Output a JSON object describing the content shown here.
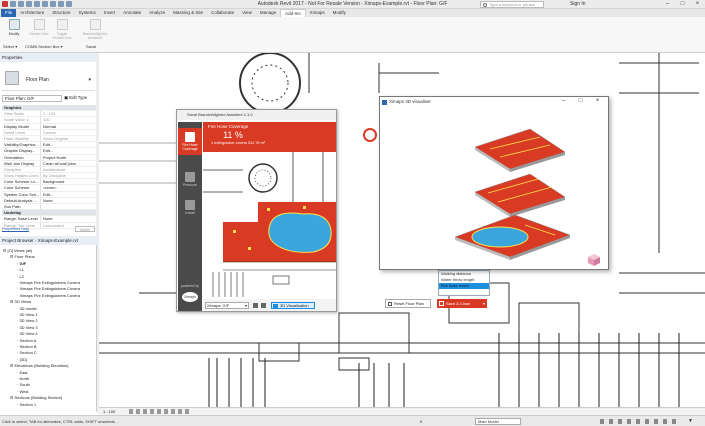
{
  "app_title": "Autodesk Revit 2017 - Not For Resale Version - Ximaps-Example.rvt - Floor Plan: G/F",
  "search_placeholder": "Type a keyword or phrase",
  "sign_in": "Sign In",
  "tabs": [
    "File",
    "Architecture",
    "Structure",
    "Systems",
    "Insert",
    "Annotate",
    "Analyze",
    "Massing & Site",
    "Collaborate",
    "View",
    "Manage",
    "Add-Ins",
    "Ximaps",
    "Modify"
  ],
  "active_tab": "Add-Ins",
  "ribbon": {
    "modify": "Modify",
    "buttons": [
      "Section Box",
      "Toggle Section Box",
      "Section Box",
      "Brandveiligheid Assistent"
    ],
    "panels": [
      "Select ▾",
      "COMB Section Box ▾",
      "Saval"
    ]
  },
  "properties": {
    "header": "Properties",
    "type_name": "Floor Plan",
    "selector": "Floor Plan: G/F",
    "edit_type": "Edit Type",
    "rows": [
      {
        "k": "Graphics",
        "v": "",
        "hdr": true
      },
      {
        "k": "View Scale",
        "v": "1 : 100",
        "grey": true
      },
      {
        "k": "Scale Value 1:",
        "v": "100",
        "grey": true
      },
      {
        "k": "Display Model",
        "v": "Normal"
      },
      {
        "k": "Detail Level",
        "v": "Coarse",
        "grey": true
      },
      {
        "k": "Parts Visibility",
        "v": "Show Original",
        "grey": true
      },
      {
        "k": "Visibility/Graphics...",
        "v": "Edit..."
      },
      {
        "k": "Graphic Display...",
        "v": "Edit..."
      },
      {
        "k": "Orientation",
        "v": "Project North"
      },
      {
        "k": "Wall Join Display",
        "v": "Clean all wall joins"
      },
      {
        "k": "Discipline",
        "v": "Architectural",
        "grey": true
      },
      {
        "k": "Show Hidden Lines",
        "v": "By Discipline",
        "grey": true
      },
      {
        "k": "Color Scheme Lo...",
        "v": "Background"
      },
      {
        "k": "Color Scheme",
        "v": "<none>"
      },
      {
        "k": "System Color Sch...",
        "v": "Edit..."
      },
      {
        "k": "Default Analysis ...",
        "v": "None"
      },
      {
        "k": "Sun Path",
        "v": ""
      },
      {
        "k": "Underlay",
        "v": "",
        "hdr": true
      },
      {
        "k": "Range: Base Level",
        "v": "None"
      },
      {
        "k": "Range: Top Level",
        "v": "Unbounded",
        "grey": true
      }
    ],
    "help_link": "Properties help",
    "apply": "Apply"
  },
  "browser": {
    "header": "Project Browser - Ximaps-Example.rvt",
    "items": [
      {
        "t": "[O] Views (all)",
        "d": 0
      },
      {
        "t": "Floor Plans",
        "d": 1
      },
      {
        "t": "G/F",
        "d": 2,
        "bold": true
      },
      {
        "t": "L1",
        "d": 2
      },
      {
        "t": "L2",
        "d": 2
      },
      {
        "t": "Ximaps Fire Extinguishers Covera",
        "d": 2
      },
      {
        "t": "Ximaps Fire Extinguishers Covera",
        "d": 2
      },
      {
        "t": "Ximaps Fire Extinguishers Covera",
        "d": 2
      },
      {
        "t": "3D Views",
        "d": 1
      },
      {
        "t": "3D model",
        "d": 2
      },
      {
        "t": "3D View 1",
        "d": 2
      },
      {
        "t": "3D View 2",
        "d": 2
      },
      {
        "t": "3D View 3",
        "d": 2
      },
      {
        "t": "3D View 4",
        "d": 2
      },
      {
        "t": "Section A",
        "d": 2
      },
      {
        "t": "Section B",
        "d": 2
      },
      {
        "t": "Section C",
        "d": 2
      },
      {
        "t": "{3D}",
        "d": 2
      },
      {
        "t": "Elevations (Building Elevation)",
        "d": 1
      },
      {
        "t": "East",
        "d": 2
      },
      {
        "t": "North",
        "d": 2
      },
      {
        "t": "South",
        "d": 2
      },
      {
        "t": "West",
        "d": 2
      },
      {
        "t": "Sections (Building Section)",
        "d": 1
      },
      {
        "t": "Section 1",
        "d": 2
      }
    ]
  },
  "status_bar": {
    "scale": "1 : 100",
    "hint": "Click to select, TAB for alternates, CTRL adds, SHIFT unselects.",
    "model": "Main Model",
    "zero": "0"
  },
  "dialog": {
    "title": "Saval Brandveiligheid Assistent 1.1.0",
    "side": [
      {
        "label": "Fire Hose Coverage",
        "active": true
      },
      {
        "label": "Pressure"
      },
      {
        "label": "Install"
      }
    ],
    "powered_by": "powered by",
    "brand": "Ximaps",
    "coverage_title": "Fire Hose Coverage",
    "coverage_pct": "11 %",
    "coverage_sub": "1 extinguisher covers 312.76 m²",
    "level_select": "Ximaps: G/F",
    "viz_button": "3D Visualisation",
    "reset_button": "Reset Floor Plan",
    "save_button": "Save & Close"
  },
  "visualizer": {
    "title": "Ximaps 3D visualiser"
  },
  "dropdown_menu": [
    "Walking distance",
    "Water throw length",
    "Fire hose reach"
  ],
  "dropdown_selected": "Fire hose reach",
  "colors": {
    "accent": "#d93a24",
    "pool": "#3aa6dc",
    "revit_blue": "#2c67b1"
  }
}
